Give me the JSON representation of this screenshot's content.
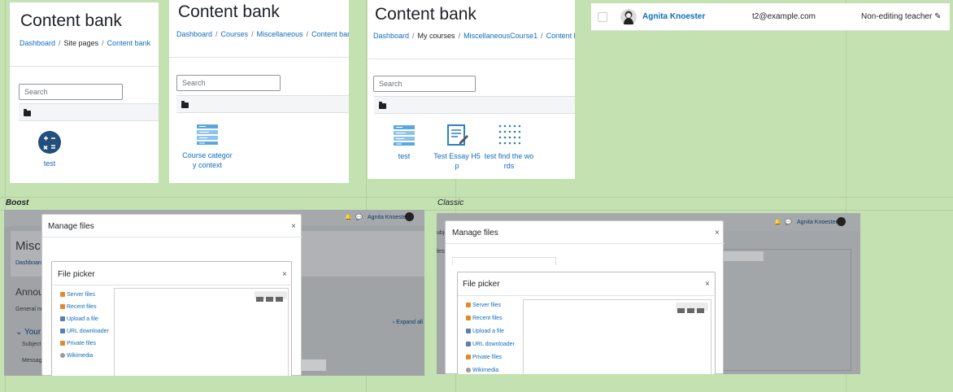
{
  "panel1": {
    "title": "Content bank",
    "breadcrumb": [
      "Dashboard",
      "Site pages",
      "Content bank"
    ],
    "search_placeholder": "Search",
    "items": [
      {
        "label": "test",
        "icon": "calculator-icon"
      }
    ]
  },
  "panel2": {
    "title": "Content bank",
    "breadcrumb": [
      "Dashboard",
      "Courses",
      "Miscellaneous",
      "Content bank"
    ],
    "search_placeholder": "Search",
    "items": [
      {
        "label": "Course categor y context",
        "line1": "Course categor",
        "line2": "y context",
        "icon": "course-presentation-icon"
      }
    ]
  },
  "panel3": {
    "title": "Content bank",
    "breadcrumb": [
      "Dashboard",
      "My courses",
      "MiscellaneousCourse1",
      "Content bank"
    ],
    "search_placeholder": "Search",
    "items": [
      {
        "label": "test",
        "icon": "course-presentation-icon"
      },
      {
        "line1": "Test Essay H5",
        "line2": "p",
        "icon": "essay-icon"
      },
      {
        "line1": "test find the wo",
        "line2": "rds",
        "icon": "find-the-words-icon"
      }
    ]
  },
  "participant": {
    "name": "Agnita Knoester",
    "email": "t2@example.com",
    "role": "Non-editing teacher"
  },
  "captions": {
    "boost": "Boost",
    "classic": "Classic"
  },
  "boost": {
    "user": "Agnita Knoester",
    "page_title": "Misc",
    "breadcrumb": "Dashboard",
    "announcements": "Annou",
    "general_news": "General new",
    "your": "Your",
    "subject": "Subject",
    "message": "Messag",
    "expand_all": "Expand all",
    "manage_files": "Manage files",
    "file_picker": "File picker",
    "repos": [
      "Server files",
      "Recent files",
      "Upload a file",
      "URL downloader",
      "Private files",
      "Wikimedia"
    ]
  },
  "classic": {
    "user": "Agnita Knoester",
    "side_text_1": "ubje",
    "side_text_2": "less",
    "manage_files": "Manage files",
    "file_picker": "File picker",
    "repos": [
      "Server files",
      "Recent files",
      "Upload a file",
      "URL downloader",
      "Private files",
      "Wikimedia"
    ]
  },
  "colors": {
    "link": "#0f6cbf",
    "background": "#c4e1b1"
  }
}
